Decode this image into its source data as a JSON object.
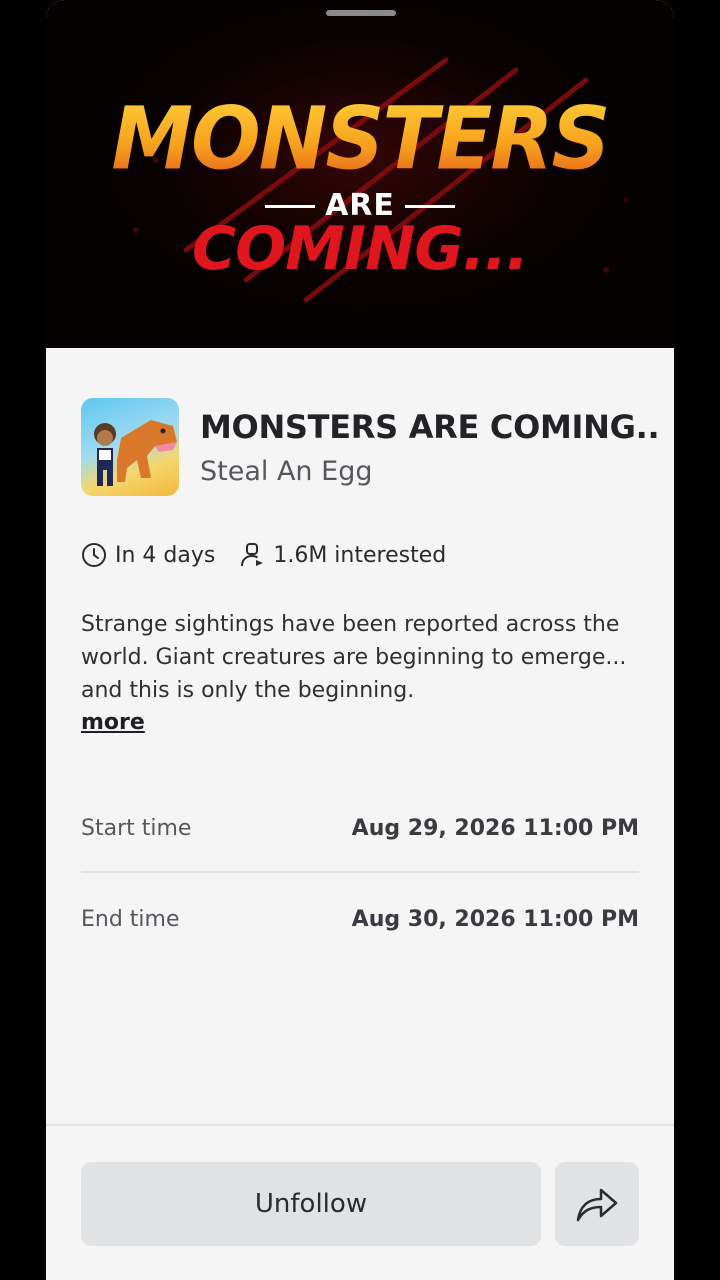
{
  "banner": {
    "line1": "MONSTERS",
    "line2": "ARE",
    "line3": "COMING..."
  },
  "event": {
    "title": "MONSTERS ARE COMING...",
    "game_name": "Steal An Egg",
    "when": "In 4 days",
    "interested": "1.6M interested",
    "description": "Strange sightings have been reported across the world. Giant creatures are beginning to emerge... and this is only the beginning.",
    "more_label": "more"
  },
  "schedule": [
    {
      "label": "Start time",
      "value": "Aug 29, 2026 11:00 PM"
    },
    {
      "label": "End time",
      "value": "Aug 30, 2026 11:00 PM"
    }
  ],
  "actions": {
    "unfollow_label": "Unfollow",
    "share_icon": "share-arrow-icon"
  },
  "icons": {
    "time": "clock-icon",
    "interested": "person-interested-icon"
  },
  "colors": {
    "banner_orange": "#f7a21e",
    "banner_red": "#e0161e",
    "sheet_bg": "#f5f5f6",
    "button_bg": "#e1e2e4"
  }
}
